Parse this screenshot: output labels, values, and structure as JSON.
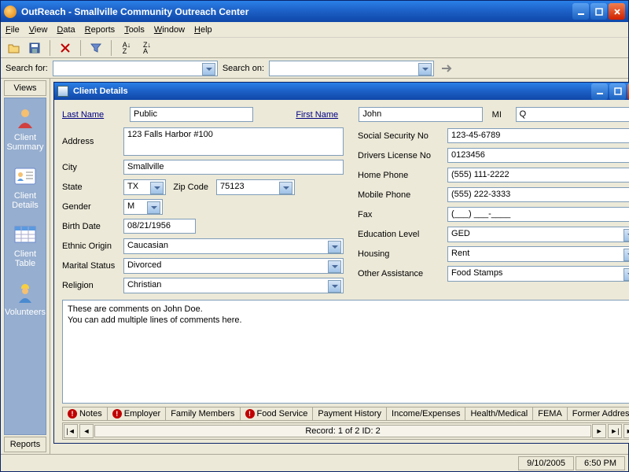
{
  "window": {
    "title": "OutReach - Smallville Community Outreach Center"
  },
  "menu": {
    "file": "File",
    "view": "View",
    "data": "Data",
    "reports": "Reports",
    "tools": "Tools",
    "window": "Window",
    "help": "Help"
  },
  "search": {
    "for_label": "Search for:",
    "for_value": "",
    "on_label": "Search on:",
    "on_value": ""
  },
  "sidebar": {
    "views_tab": "Views",
    "reports_tab": "Reports",
    "items": [
      {
        "label": "Client Summary"
      },
      {
        "label": "Client Details"
      },
      {
        "label": "Client Table"
      },
      {
        "label": "Volunteers"
      }
    ]
  },
  "details": {
    "title": "Client Details",
    "labels": {
      "last_name": "Last Name",
      "first_name": "First Name",
      "mi": "MI",
      "address": "Address",
      "city": "City",
      "state": "State",
      "zip": "Zip Code",
      "gender": "Gender",
      "birth": "Birth Date",
      "ethnic": "Ethnic Origin",
      "marital": "Marital Status",
      "religion": "Religion",
      "ssn": "Social Security No",
      "dl": "Drivers License No",
      "home": "Home Phone",
      "mobile": "Mobile Phone",
      "fax": "Fax",
      "education": "Education Level",
      "housing": "Housing",
      "other": "Other Assistance"
    },
    "values": {
      "last_name": "Public",
      "first_name": "John",
      "mi": "Q",
      "address": "123 Falls Harbor #100",
      "city": "Smallville",
      "state": "TX",
      "zip": "75123",
      "gender": "M",
      "birth": "08/21/1956",
      "ethnic": "Caucasian",
      "marital": "Divorced",
      "religion": "Christian",
      "ssn": "123-45-6789",
      "dl": "0123456",
      "home": "(555) 111-2222",
      "mobile": "(555) 222-3333",
      "fax": "(___) ___-____",
      "education": "GED",
      "housing": "Rent",
      "other": "Food Stamps"
    },
    "comments": "These are comments on John Doe.\nYou can add multiple lines of comments here.",
    "tabs": [
      {
        "label": "Notes",
        "warn": true
      },
      {
        "label": "Employer",
        "warn": true
      },
      {
        "label": "Family Members",
        "warn": false
      },
      {
        "label": "Food Service",
        "warn": true
      },
      {
        "label": "Payment History",
        "warn": false
      },
      {
        "label": "Income/Expenses",
        "warn": false
      },
      {
        "label": "Health/Medical",
        "warn": false
      },
      {
        "label": "FEMA",
        "warn": false
      },
      {
        "label": "Former Address",
        "warn": false
      }
    ],
    "record_status": "Record: 1 of 2     ID: 2"
  },
  "status": {
    "date": "9/10/2005",
    "time": "6:50 PM"
  }
}
